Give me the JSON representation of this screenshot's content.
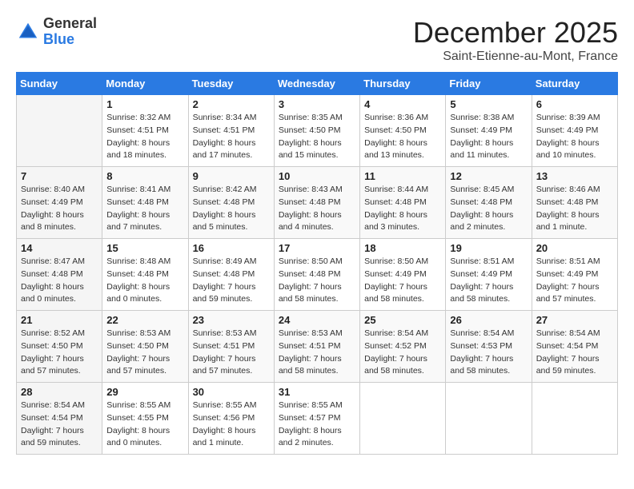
{
  "header": {
    "logo_general": "General",
    "logo_blue": "Blue",
    "month": "December 2025",
    "location": "Saint-Etienne-au-Mont, France"
  },
  "columns": [
    "Sunday",
    "Monday",
    "Tuesday",
    "Wednesday",
    "Thursday",
    "Friday",
    "Saturday"
  ],
  "weeks": [
    [
      {
        "day": "",
        "info": ""
      },
      {
        "day": "1",
        "info": "Sunrise: 8:32 AM\nSunset: 4:51 PM\nDaylight: 8 hours\nand 18 minutes."
      },
      {
        "day": "2",
        "info": "Sunrise: 8:34 AM\nSunset: 4:51 PM\nDaylight: 8 hours\nand 17 minutes."
      },
      {
        "day": "3",
        "info": "Sunrise: 8:35 AM\nSunset: 4:50 PM\nDaylight: 8 hours\nand 15 minutes."
      },
      {
        "day": "4",
        "info": "Sunrise: 8:36 AM\nSunset: 4:50 PM\nDaylight: 8 hours\nand 13 minutes."
      },
      {
        "day": "5",
        "info": "Sunrise: 8:38 AM\nSunset: 4:49 PM\nDaylight: 8 hours\nand 11 minutes."
      },
      {
        "day": "6",
        "info": "Sunrise: 8:39 AM\nSunset: 4:49 PM\nDaylight: 8 hours\nand 10 minutes."
      }
    ],
    [
      {
        "day": "7",
        "info": "Sunrise: 8:40 AM\nSunset: 4:49 PM\nDaylight: 8 hours\nand 8 minutes."
      },
      {
        "day": "8",
        "info": "Sunrise: 8:41 AM\nSunset: 4:48 PM\nDaylight: 8 hours\nand 7 minutes."
      },
      {
        "day": "9",
        "info": "Sunrise: 8:42 AM\nSunset: 4:48 PM\nDaylight: 8 hours\nand 5 minutes."
      },
      {
        "day": "10",
        "info": "Sunrise: 8:43 AM\nSunset: 4:48 PM\nDaylight: 8 hours\nand 4 minutes."
      },
      {
        "day": "11",
        "info": "Sunrise: 8:44 AM\nSunset: 4:48 PM\nDaylight: 8 hours\nand 3 minutes."
      },
      {
        "day": "12",
        "info": "Sunrise: 8:45 AM\nSunset: 4:48 PM\nDaylight: 8 hours\nand 2 minutes."
      },
      {
        "day": "13",
        "info": "Sunrise: 8:46 AM\nSunset: 4:48 PM\nDaylight: 8 hours\nand 1 minute."
      }
    ],
    [
      {
        "day": "14",
        "info": "Sunrise: 8:47 AM\nSunset: 4:48 PM\nDaylight: 8 hours\nand 0 minutes."
      },
      {
        "day": "15",
        "info": "Sunrise: 8:48 AM\nSunset: 4:48 PM\nDaylight: 8 hours\nand 0 minutes."
      },
      {
        "day": "16",
        "info": "Sunrise: 8:49 AM\nSunset: 4:48 PM\nDaylight: 7 hours\nand 59 minutes."
      },
      {
        "day": "17",
        "info": "Sunrise: 8:50 AM\nSunset: 4:48 PM\nDaylight: 7 hours\nand 58 minutes."
      },
      {
        "day": "18",
        "info": "Sunrise: 8:50 AM\nSunset: 4:49 PM\nDaylight: 7 hours\nand 58 minutes."
      },
      {
        "day": "19",
        "info": "Sunrise: 8:51 AM\nSunset: 4:49 PM\nDaylight: 7 hours\nand 58 minutes."
      },
      {
        "day": "20",
        "info": "Sunrise: 8:51 AM\nSunset: 4:49 PM\nDaylight: 7 hours\nand 57 minutes."
      }
    ],
    [
      {
        "day": "21",
        "info": "Sunrise: 8:52 AM\nSunset: 4:50 PM\nDaylight: 7 hours\nand 57 minutes."
      },
      {
        "day": "22",
        "info": "Sunrise: 8:53 AM\nSunset: 4:50 PM\nDaylight: 7 hours\nand 57 minutes."
      },
      {
        "day": "23",
        "info": "Sunrise: 8:53 AM\nSunset: 4:51 PM\nDaylight: 7 hours\nand 57 minutes."
      },
      {
        "day": "24",
        "info": "Sunrise: 8:53 AM\nSunset: 4:51 PM\nDaylight: 7 hours\nand 58 minutes."
      },
      {
        "day": "25",
        "info": "Sunrise: 8:54 AM\nSunset: 4:52 PM\nDaylight: 7 hours\nand 58 minutes."
      },
      {
        "day": "26",
        "info": "Sunrise: 8:54 AM\nSunset: 4:53 PM\nDaylight: 7 hours\nand 58 minutes."
      },
      {
        "day": "27",
        "info": "Sunrise: 8:54 AM\nSunset: 4:54 PM\nDaylight: 7 hours\nand 59 minutes."
      }
    ],
    [
      {
        "day": "28",
        "info": "Sunrise: 8:54 AM\nSunset: 4:54 PM\nDaylight: 7 hours\nand 59 minutes."
      },
      {
        "day": "29",
        "info": "Sunrise: 8:55 AM\nSunset: 4:55 PM\nDaylight: 8 hours\nand 0 minutes."
      },
      {
        "day": "30",
        "info": "Sunrise: 8:55 AM\nSunset: 4:56 PM\nDaylight: 8 hours\nand 1 minute."
      },
      {
        "day": "31",
        "info": "Sunrise: 8:55 AM\nSunset: 4:57 PM\nDaylight: 8 hours\nand 2 minutes."
      },
      {
        "day": "",
        "info": ""
      },
      {
        "day": "",
        "info": ""
      },
      {
        "day": "",
        "info": ""
      }
    ]
  ]
}
